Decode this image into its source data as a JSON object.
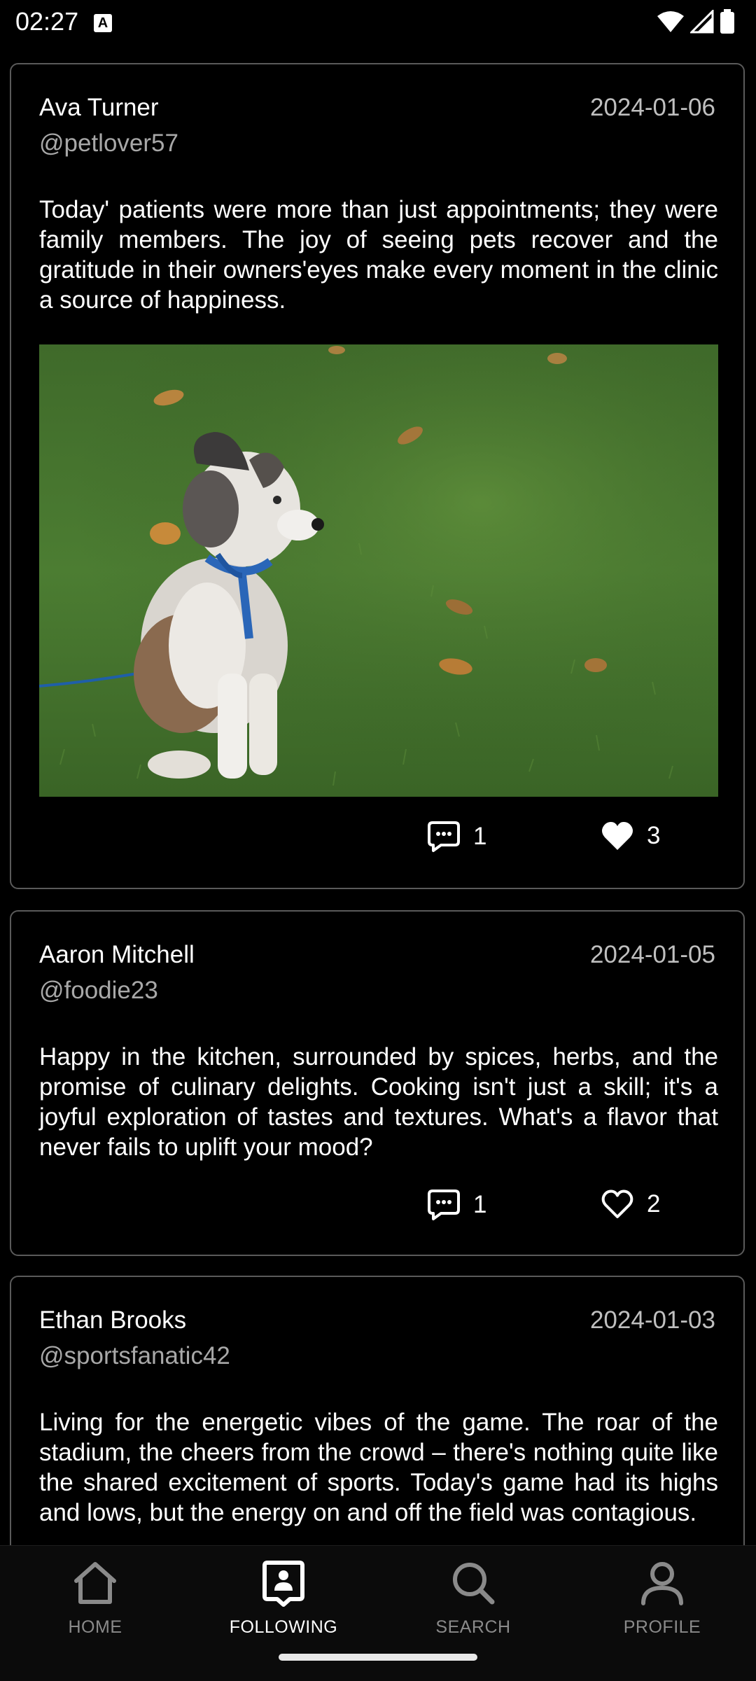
{
  "status_bar": {
    "time": "02:27",
    "notification_icon": "A"
  },
  "posts": [
    {
      "author": "Ava Turner",
      "handle": "@petlover57",
      "date": "2024-01-06",
      "text": "Today' patients were more than just appointments; they were family members. The joy of seeing pets recover and the gratitude in their owners'eyes make every moment in the clinic a source of happiness.",
      "has_image": true,
      "image_subject": "puppy-on-grass",
      "comments": "1",
      "likes": "3",
      "liked": true
    },
    {
      "author": "Aaron Mitchell",
      "handle": "@foodie23",
      "date": "2024-01-05",
      "text": "Happy in the kitchen, surrounded by spices, herbs, and the promise of culinary delights. Cooking isn't just a skill; it's a joyful exploration of tastes and textures. What's a flavor that never fails to uplift your mood?",
      "has_image": false,
      "comments": "1",
      "likes": "2",
      "liked": false
    },
    {
      "author": "Ethan Brooks",
      "handle": "@sportsfanatic42",
      "date": "2024-01-03",
      "text": "Living for the energetic vibes of the game. The roar of the stadium, the cheers from the crowd – there's nothing quite like the shared excitement of sports. Today's game had its highs and lows, but the energy on and off the field was contagious."
    }
  ],
  "bottom_nav": {
    "items": [
      {
        "label": "HOME",
        "icon": "home-icon",
        "active": false
      },
      {
        "label": "FOLLOWING",
        "icon": "following-icon",
        "active": true
      },
      {
        "label": "SEARCH",
        "icon": "search-icon",
        "active": false
      },
      {
        "label": "PROFILE",
        "icon": "profile-icon",
        "active": false
      }
    ]
  },
  "colors": {
    "background": "#000000",
    "card_border": "#5a5a5a",
    "muted_text": "#a8a8a8",
    "nav_inactive": "#8a8a8a",
    "nav_active": "#ffffff"
  }
}
